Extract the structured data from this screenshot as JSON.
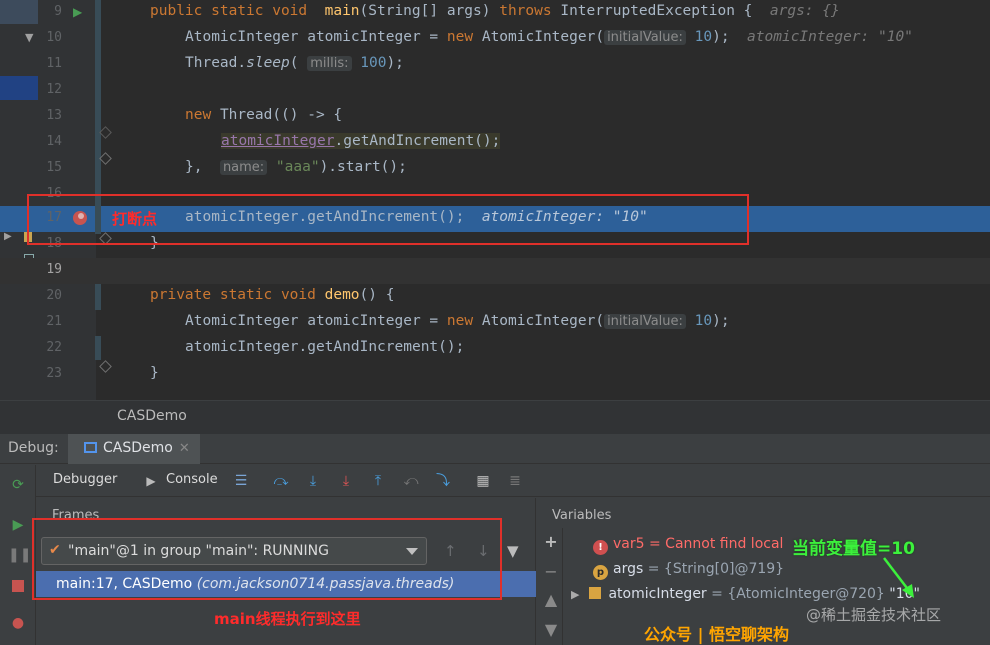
{
  "editor": {
    "lines": [
      {
        "n": "9"
      },
      {
        "n": "10"
      },
      {
        "n": "11"
      },
      {
        "n": "12"
      },
      {
        "n": "13"
      },
      {
        "n": "14"
      },
      {
        "n": "15"
      },
      {
        "n": "16"
      },
      {
        "n": "17"
      },
      {
        "n": "18"
      },
      {
        "n": "19"
      },
      {
        "n": "20"
      },
      {
        "n": "21"
      },
      {
        "n": "22"
      },
      {
        "n": "23"
      }
    ],
    "code": {
      "l9_kw": "public static void",
      "l9_fn": "main",
      "l9_args": "(String[] args)",
      "l9_throws": "throws",
      "l9_ex": "InterruptedException {",
      "l9_hint": "args: {}",
      "l10_decl": "AtomicInteger atomicInteger = ",
      "l10_new": "new",
      "l10_cls": "AtomicInteger(",
      "l10_param": "initialValue:",
      "l10_num": "10",
      "l10_end": ");",
      "l10_hint": "atomicInteger: \"10\"",
      "l11_a": "Thread.",
      "l11_sleep": "sleep",
      "l11_b": "(",
      "l11_param": "millis:",
      "l11_num": "100",
      "l11_end": ");",
      "l13_new": "new",
      "l13_rest": "Thread(() -> {",
      "l14_field": "atomicInteger",
      "l14_rest": ".getAndIncrement();",
      "l15_a": "},",
      "l15_param": "name:",
      "l15_str": "\"aaa\"",
      "l15_end": ").start();",
      "l17_code": "atomicInteger.getAndIncrement();",
      "l17_hint": "atomicInteger: \"10\"",
      "l18": "}",
      "l20_kw": "private static void",
      "l20_fn": "demo",
      "l20_end": "() {",
      "l21_decl": "AtomicInteger atomicInteger = ",
      "l21_new": "new",
      "l21_cls": "AtomicInteger(",
      "l21_param": "initialValue:",
      "l21_num": "10",
      "l21_end": ");",
      "l22": "atomicInteger.getAndIncrement();",
      "l23": "}"
    },
    "annotation_breakpoint": "打断点"
  },
  "breadcrumb": {
    "label": "CASDemo"
  },
  "debug": {
    "title": "Debug:",
    "tab": "CASDemo",
    "tabs": {
      "debugger": "Debugger",
      "console": "Console"
    },
    "frames": {
      "header": "Frames",
      "thread": "\"main\"@1 in group \"main\": RUNNING",
      "frame_main": "main:17, CASDemo",
      "frame_pkg": "(com.jackson0714.passjava.threads)"
    },
    "variables": {
      "header": "Variables",
      "items": [
        {
          "badge": "!",
          "name": "var5",
          "eq": " = ",
          "value": "Cannot find local"
        },
        {
          "badge": "p",
          "name": "args",
          "eq": " = ",
          "value": "{String[0]@719}"
        },
        {
          "name": "atomicInteger",
          "eq": " = ",
          "type": "{AtomicInteger@720}",
          "value": " \"10\""
        }
      ]
    },
    "annotation_main": "main线程执行到这里",
    "annotation_value": "当前变量值=10"
  },
  "watermark": {
    "site": "@稀土掘金技术社区",
    "pub": "公众号 | 悟空聊架构"
  },
  "colors": {
    "exec_line": "#2d6099",
    "annotation_red": "#e0302a",
    "annotation_green": "#3cf03c",
    "selection": "#4b6eaf"
  },
  "icons": [
    "run-arrow-icon",
    "breakpoint-icon",
    "resume-icon",
    "pause-icon",
    "stop-icon",
    "step-over-icon",
    "step-into-icon",
    "force-step-into-icon",
    "step-out-icon",
    "evaluate-icon",
    "filter-icon",
    "add-watch-icon"
  ]
}
